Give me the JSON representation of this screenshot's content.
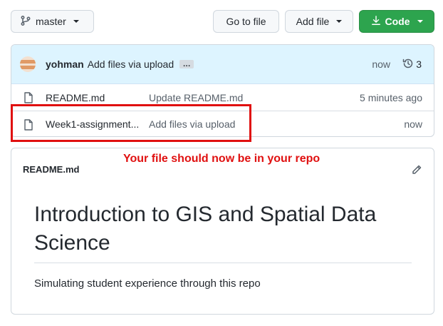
{
  "toolbar": {
    "branch_label": "master",
    "goto_file_label": "Go to file",
    "add_file_label": "Add file",
    "code_label": "Code"
  },
  "latest_commit": {
    "author": "yohman",
    "message": "Add files via upload",
    "ellipsis": "…",
    "time": "now",
    "commit_count": "3"
  },
  "files": [
    {
      "name": "README.md",
      "commit_message": "Update README.md",
      "age": "5 minutes ago"
    },
    {
      "name": "Week1-assignment...",
      "commit_message": "Add files via upload",
      "age": "now"
    }
  ],
  "annotation": "Your file should now be in your repo",
  "readme": {
    "filename": "README.md",
    "heading": "Introduction to GIS and Spatial Data Science",
    "description": "Simulating student experience through this repo"
  },
  "colors": {
    "code_button": "#2da44e",
    "commit_bar": "#ddf4ff",
    "annotation": "#e01010"
  }
}
